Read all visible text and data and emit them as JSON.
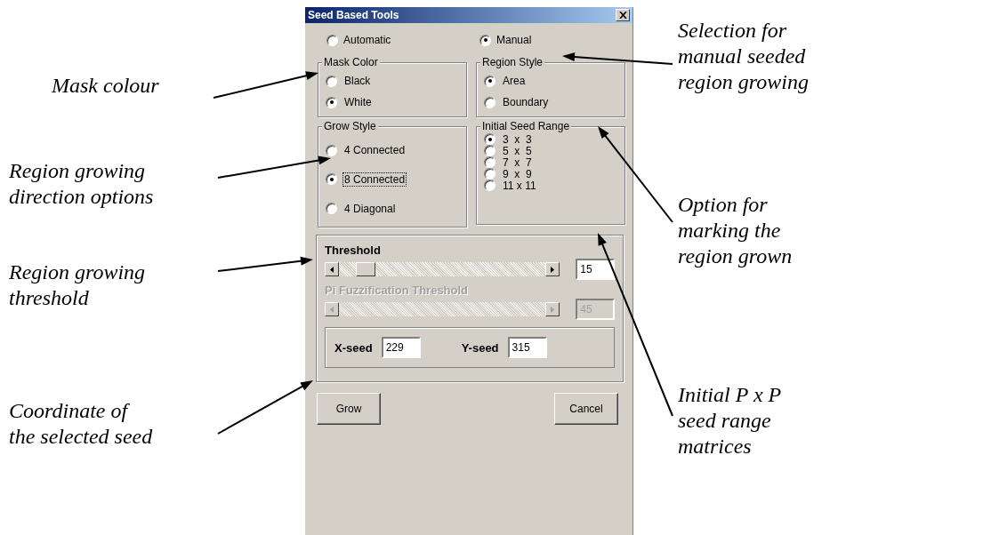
{
  "annotations_left": [
    {
      "lines": [
        "Mask colour"
      ]
    },
    {
      "lines": [
        "Region growing",
        "direction options"
      ]
    },
    {
      "lines": [
        "Region growing",
        "threshold"
      ]
    },
    {
      "lines": [
        "Coordinate of",
        "the selected seed"
      ]
    }
  ],
  "annotations_right": [
    {
      "lines": [
        "Selection for",
        "manual seeded",
        "region growing"
      ]
    },
    {
      "lines": [
        "Option for",
        "marking the",
        "region grown"
      ]
    },
    {
      "lines": [
        "Initial P x P",
        "seed range",
        "matrices"
      ]
    }
  ],
  "dialog": {
    "title": "Seed Based Tools",
    "mode_options": [
      {
        "label": "Automatic",
        "selected": false
      },
      {
        "label": "Manual",
        "selected": true
      }
    ],
    "groups": [
      {
        "title": "Mask Color",
        "kind": "normal",
        "options": [
          {
            "label": "Black",
            "selected": false
          },
          {
            "label": "White",
            "selected": true
          }
        ]
      },
      {
        "title": "Region Style",
        "kind": "normal",
        "options": [
          {
            "label": "Area",
            "selected": true
          },
          {
            "label": "Boundary",
            "selected": false
          }
        ]
      },
      {
        "title": "Grow Style",
        "kind": "spaced",
        "options": [
          {
            "label": "4 Connected",
            "selected": false,
            "focused": false
          },
          {
            "label": "8 Connected",
            "selected": true,
            "focused": true
          },
          {
            "label": "4 Diagonal",
            "selected": false,
            "focused": false
          }
        ]
      },
      {
        "title": "Initial Seed Range",
        "kind": "compact",
        "options": [
          {
            "label": "3  x  3",
            "selected": true
          },
          {
            "label": "5  x  5",
            "selected": false
          },
          {
            "label": "7  x  7",
            "selected": false
          },
          {
            "label": "9  x  9",
            "selected": false
          },
          {
            "label": "11 x 11",
            "selected": false
          }
        ]
      }
    ],
    "sliders": [
      {
        "label": "Threshold",
        "disabled": false,
        "level": 0.09,
        "value": "15"
      },
      {
        "label": "Pi Fuzzification Threshold",
        "disabled": true,
        "value": "45"
      }
    ],
    "seeds": [
      {
        "label": "X-seed",
        "value": "229"
      },
      {
        "label": "Y-seed",
        "value": "315"
      }
    ],
    "buttons": [
      "Grow",
      "Cancel"
    ]
  }
}
